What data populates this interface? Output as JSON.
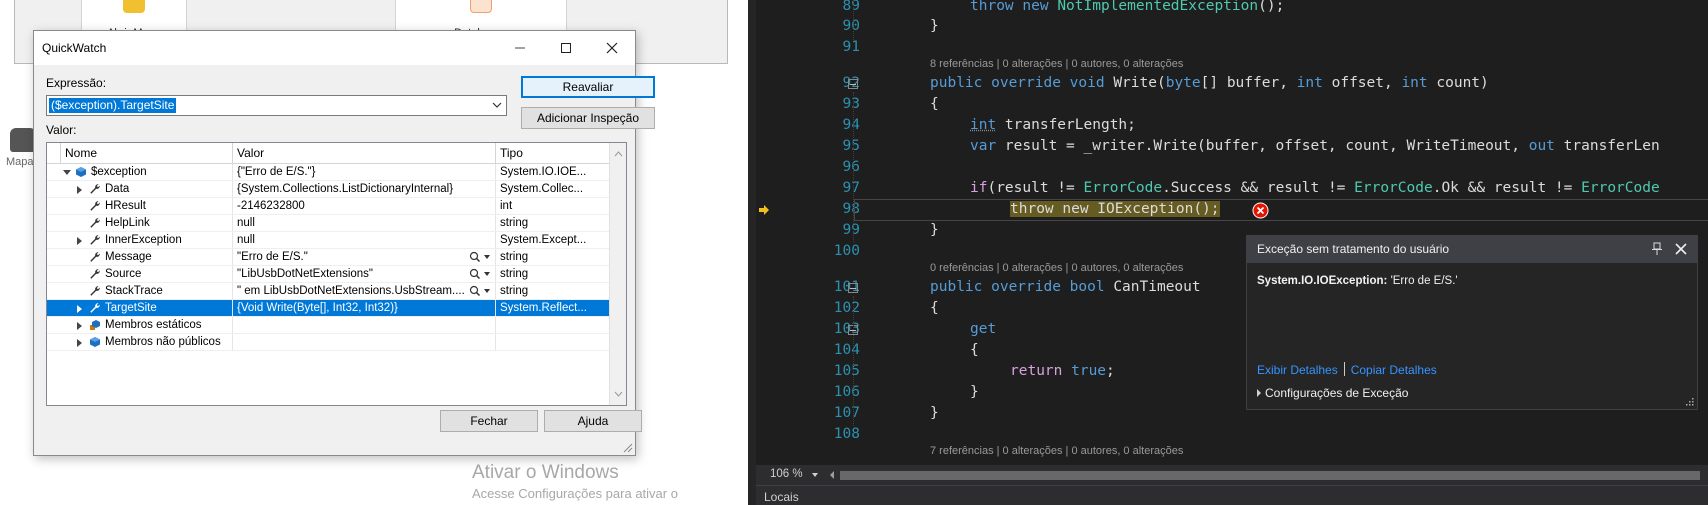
{
  "background_app": {
    "toolbar_buttons": [
      "Abrir Mapa",
      "Datalogger"
    ],
    "side_label": "Mapa"
  },
  "quickwatch": {
    "title": "QuickWatch",
    "expression_label": "Expressão:",
    "expression_value": "($exception).TargetSite",
    "reevaluate_label": "Reavaliar",
    "add_watch_label": "Adicionar Inspeção",
    "value_label": "Valor:",
    "columns": [
      "Nome",
      "Valor",
      "Tipo"
    ],
    "rows": [
      {
        "name": "$exception",
        "value": "{\"Erro de E/S.\"}",
        "type": "System.IO.IOE...",
        "icon": "object-icon",
        "expander": "expanded"
      },
      {
        "name": "Data",
        "value": "{System.Collections.ListDictionaryInternal}",
        "type": "System.Collec...",
        "icon": "wrench-icon",
        "expander": "collapsed"
      },
      {
        "name": "HResult",
        "value": "-2146232800",
        "type": "int",
        "icon": "wrench-icon",
        "expander": "none"
      },
      {
        "name": "HelpLink",
        "value": "null",
        "type": "string",
        "icon": "wrench-icon",
        "expander": "none"
      },
      {
        "name": "InnerException",
        "value": "null",
        "type": "System.Except...",
        "icon": "wrench-icon",
        "expander": "collapsed"
      },
      {
        "name": "Message",
        "value": "\"Erro de E/S.\"",
        "type": "string",
        "icon": "wrench-icon",
        "expander": "none",
        "magnifier": true
      },
      {
        "name": "Source",
        "value": "\"LibUsbDotNetExtensions\"",
        "type": "string",
        "icon": "wrench-icon",
        "expander": "none",
        "magnifier": true
      },
      {
        "name": "StackTrace",
        "value": "\"   em LibUsbDotNetExtensions.UsbStream....",
        "type": "string",
        "icon": "wrench-icon",
        "expander": "none",
        "magnifier": true
      },
      {
        "name": "TargetSite",
        "value": "{Void Write(Byte[], Int32, Int32)}",
        "type": "System.Reflect...",
        "icon": "wrench-icon",
        "expander": "collapsed",
        "selected": true
      },
      {
        "name": "Membros estáticos",
        "value": "",
        "type": "",
        "icon": "static-members-icon",
        "expander": "collapsed"
      },
      {
        "name": "Membros não públicos",
        "value": "",
        "type": "",
        "icon": "nonpublic-members-icon",
        "expander": "collapsed"
      }
    ],
    "close_label": "Fechar",
    "help_label": "Ajuda"
  },
  "watermark": {
    "title": "Ativar o Windows",
    "subtitle": "Acesse Configurações para ativar o"
  },
  "editor": {
    "lines": [
      {
        "num": "89"
      },
      {
        "num": "90"
      },
      {
        "num": "91"
      },
      {
        "num": "92"
      },
      {
        "num": "93"
      },
      {
        "num": "94"
      },
      {
        "num": "95"
      },
      {
        "num": "96"
      },
      {
        "num": "97"
      },
      {
        "num": "98"
      },
      {
        "num": "99"
      },
      {
        "num": "100"
      },
      {
        "num": "101"
      },
      {
        "num": "102"
      },
      {
        "num": "103"
      },
      {
        "num": "104"
      },
      {
        "num": "105"
      },
      {
        "num": "106"
      },
      {
        "num": "107"
      },
      {
        "num": "108"
      }
    ],
    "code": {
      "l89_kw": "throw new ",
      "l89_ty": "NotImplementedException",
      "l89_rest": "();",
      "l90": "}",
      "lens1": "8 referências | 0 alterações | 0 autores, 0 alterações",
      "l92_kw": "public override void ",
      "l92_a": "Write(",
      "l92_byte": "byte",
      "l92_b": "[] buffer, ",
      "l92_int1": "int",
      "l92_c": " offset, ",
      "l92_int2": "int",
      "l92_d": " count)",
      "l93": "{",
      "l94_int": "int",
      "l94_rest": " transferLength;",
      "l95_var": "var",
      "l95_a": " result = _writer.Write(buffer, offset, count, WriteTimeout, ",
      "l95_out": "out",
      "l95_b": " transferLen",
      "l97_if": "if",
      "l97_a": "(result != ",
      "l97_t1": "ErrorCode",
      "l97_b": ".Success && result != ",
      "l97_t2": "ErrorCode",
      "l97_c": ".Ok && result != ",
      "l97_t3": "ErrorCode",
      "l98": "throw new IOException();",
      "l99": "}",
      "lens2": "0 referências | 0 alterações | 0 autores, 0 alterações",
      "l101_kw": "public override bool ",
      "l101_rest": "CanTimeout",
      "l102": "{",
      "l103": "get",
      "l104": "{",
      "l105_ret": "return ",
      "l105_true": "true",
      "l105_rest": ";",
      "l106": "}",
      "l107": "}",
      "lens3": "7 referências | 0 alterações | 0 autores, 0 alterações"
    },
    "exception_popup": {
      "title": "Exceção sem tratamento do usuário",
      "exception_type": "System.IO.IOException:",
      "exception_message": " 'Erro de E/S.'",
      "details_link": "Exibir Detalhes",
      "copy_link": "Copiar Detalhes",
      "settings_label": "Configurações de Exceção"
    },
    "zoom_level": "106 %",
    "bottom_tab": "Locais"
  },
  "colors": {
    "accent": "#0078d7",
    "editor_bg": "#1e1e1e",
    "keyword": "#569cd6",
    "type": "#4ec9b0",
    "line_number": "#2b91af",
    "throw_highlight": "#665c22",
    "link": "#3794ff"
  }
}
